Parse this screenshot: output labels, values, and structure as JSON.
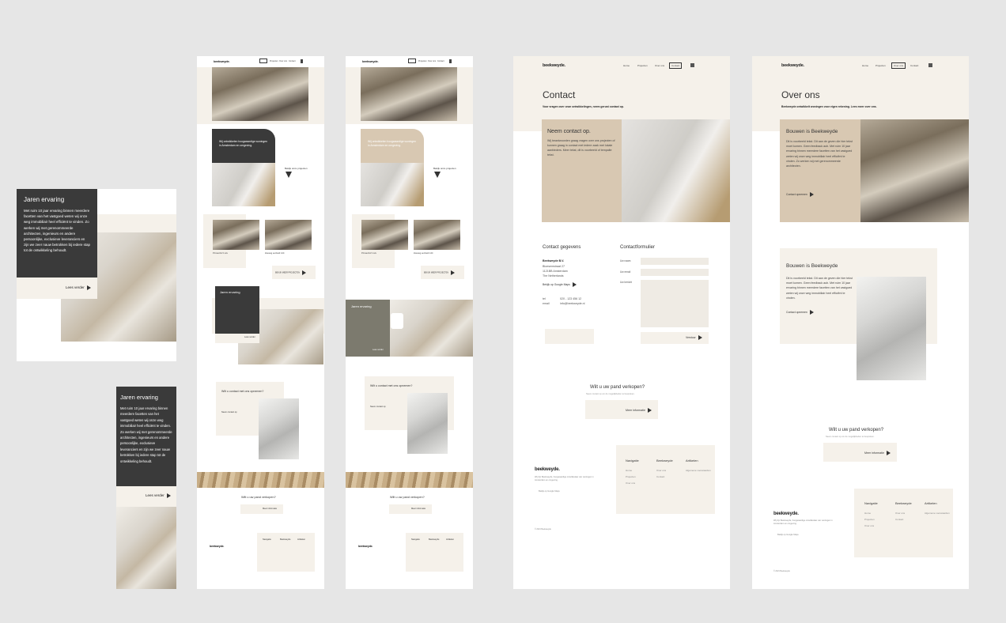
{
  "logo": "beekweyde.",
  "nav": [
    "Home",
    "Projecten",
    "Over ons",
    "Contact"
  ],
  "nav_contact": [
    "Home",
    "Projecten",
    "Over ons",
    "Contact"
  ],
  "card_ervaring": {
    "title": "Jaren ervaring",
    "body": "Met ruim 10 jaar ervaring binnen meerdere facetten van het vastgoed weten wij onze weg immobiliair heel efficiënt te vinden. Zo werken wij met gerenommeerde architecten, ingenieurs en andere persoonlijke, exclusieve leveranciers en zijn we zeer nauw betrokken bij iedere stap tot de ontwikkeling behoudt.",
    "link": "Lees verder"
  },
  "mobile_card": {
    "title": "Jaren ervaring",
    "body": "Met ruim 10 jaar ervaring binnen meerdere facetten van het vastgoed weten wij onze weg immobiliair heel efficiënt te vinden. Zo werken wij met gerenommeerde architecten, ingenieurs en andere persoonlijke, exclusieve leveranciers en zijn we zeer nauw betrokken bij iedere stap tot de ontwikkeling behoudt.",
    "link": "Lees verder"
  },
  "home": {
    "hero_quote": "Wij ontwikkelen hoogwaardige woningen in Amsterdam en omgeving.",
    "projects_link": "Bekijk onze projecten",
    "project1": "Prinsenhof 1 k/a",
    "project2": "Zeeweg eenheid 14C",
    "more_projects": "BEKIJK MEER PROJECTEN",
    "ervaring_title": "Jaren ervaring",
    "read_more": "Lees verder",
    "contact_q": "Wilt u contact met ons opnemen?",
    "contact_link": "Neem contact op",
    "sell_title": "Wilt u uw pand verkopen?",
    "sell_btn": "Meer informatie"
  },
  "contact_page": {
    "title": "Contact",
    "subtitle": "Voor vragen over onze ontwikkelingen, neem gerust contact op.",
    "box_title": "Neem contact op.",
    "box_body": "Wij beantwoorden graag vragen over ons projecten of kunnen graag in contact met iedere zaak met lokale aanbieders. Meer tekst, dit is voorbeeld of tempalte tekst.",
    "gegevens_title": "Contact gegevens",
    "company": "Beekweyde B.V.",
    "street": "Bloesemstraat 27",
    "city": "1121BB Amsterdam",
    "country": "The Netherlands",
    "route": "Bekijk op Google Maps",
    "tel_label": "tel",
    "tel": "020 - 123 456 12",
    "email_label": "email",
    "email": "info@beekweyde.nl",
    "form_title": "Contactformulier",
    "f_name": "Uw naam",
    "f_email": "Uw email",
    "f_msg": "Uw bericht",
    "submit": "Verstuur",
    "sell_title": "Wilt u uw pand verkopen?",
    "sell_sub": "Neem contact op om de mogelijkheden te bespreken.",
    "sell_btn": "Meer informatie"
  },
  "about_page": {
    "title": "Over ons",
    "subtitle": "Beekweyde ontwikkelt woningen voor eigen rekening. Lees meer over ons.",
    "box_title": "Bouwen is Beekweyde",
    "box_body": "Dit is voorbeeld tekst. Dit aan de geven die hier tekst moet komen. Geen feedback aub. Met ruim 10 jaar ervaring binnen meerdere facetten van het vastgoed weten wij onze weg immobiliair heel efficiënt te vinden. Zo werken wij met gerenommeerde architecten.",
    "box_link": "Contact opnemen",
    "box2_title": "Bouwen is Beekweyde",
    "box2_body": "Dit is voorbeeld tekst. Dit aan de geven die hier tekst moet komen. Geen feedback aub. Met ruim 10 jaar ervaring binnen meerdere facetten van het vastgoed weten wij onze weg immobiliair heel efficiënt te vinden.",
    "box2_link": "Contact opnemen",
    "sell_title": "Wilt u uw pand verkopen?",
    "sell_btn": "Meer informatie"
  },
  "footer": {
    "blurb": "Wij zijn Beekweyde, hoogwaardige ontwikkelaar van woningen in Amsterdam en omgeving.",
    "map": "Bekijk op Google Maps",
    "col1": "Navigatie",
    "col2": "Beekweyde",
    "col3": "Artikelen",
    "col1_items": [
      "Home",
      "Projecten",
      "Over ons",
      "Contact"
    ],
    "col2_items": [
      "Over ons",
      "Contact"
    ],
    "col3_items": [
      "Algemene voorwaarden"
    ],
    "copy": "© 2021 Beekweyde"
  },
  "colors": {
    "background": "#e6e6e6",
    "beige": "#f5f1ea",
    "tan": "#d8c8b2",
    "dark": "#3a3a3a"
  }
}
